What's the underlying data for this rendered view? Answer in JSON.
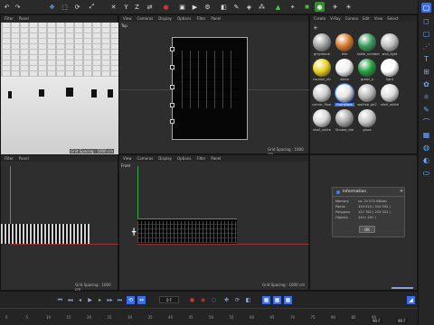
{
  "viewport_menu": [
    "View",
    "Cameras",
    "Display",
    "Options",
    "Filter",
    "Panel"
  ],
  "perspective_menu": [
    "Filter",
    "Panel"
  ],
  "viewports": {
    "persp": {
      "name": "Perspective",
      "grid": "Grid Spacing : 1000 cm"
    },
    "top": {
      "name": "Top",
      "grid": "Grid Spacing : 1000 cm"
    },
    "right": {
      "name": "Right",
      "grid": "Grid Spacing : 1000 cm"
    },
    "front": {
      "name": "Front",
      "grid": "Grid Spacing : 1000 cm"
    }
  },
  "material_menu": [
    "Create",
    "V-Ray",
    "Corona",
    "Edit",
    "View",
    "Select"
  ],
  "materials": [
    {
      "label": "greystone",
      "color": "#a0a0a0"
    },
    {
      "label": "tille",
      "color": "#d67a2a"
    },
    {
      "label": "table_number",
      "color": "#3a9a5a"
    },
    {
      "label": "wall_light",
      "color": "#bcbcbc"
    },
    {
      "label": "caution_str",
      "color": "#e8d020"
    },
    {
      "label": "white",
      "color": "#f0f0f0"
    },
    {
      "label": "green_s",
      "color": "#20a040"
    },
    {
      "label": "light",
      "color": "#ffffff"
    },
    {
      "label": "corner_floor",
      "color": "#cfcfcf"
    },
    {
      "label": "frameless",
      "color": "#e6e6e6"
    },
    {
      "label": "wallfab_pb2",
      "color": "#b8b8b8"
    },
    {
      "label": "shell_white",
      "color": "#dddddd"
    },
    {
      "label": "shell_white",
      "color": "#d8d8d8"
    },
    {
      "label": "Shrade_tile",
      "color": "#a8a8a8"
    },
    {
      "label": "glass",
      "color": "#c8c8c8"
    }
  ],
  "info_dialog": {
    "title": "Information",
    "rows": [
      {
        "label": "Memory",
        "value": "ca. 22 072 KB/sec"
      },
      {
        "label": "Points",
        "value": "194 010 ( 310 552 )"
      },
      {
        "label": "Polygons",
        "value": "137 762 ( 219 312 )"
      },
      {
        "label": "Objects",
        "value": "144 ( 497 )"
      }
    ],
    "ok": "OK"
  },
  "timeline": {
    "frame_field": "0 F",
    "ticks": [
      "0",
      "5",
      "10",
      "15",
      "20",
      "25",
      "30",
      "35",
      "40",
      "45",
      "50",
      "55",
      "60",
      "65",
      "70",
      "75",
      "80",
      "85",
      "90"
    ],
    "end_fields": [
      "90 F",
      "90 F"
    ]
  },
  "colors": {
    "accent": "#3a6ee8",
    "y_axis": "#2ea84a",
    "x_axis": "#d33a3a"
  }
}
